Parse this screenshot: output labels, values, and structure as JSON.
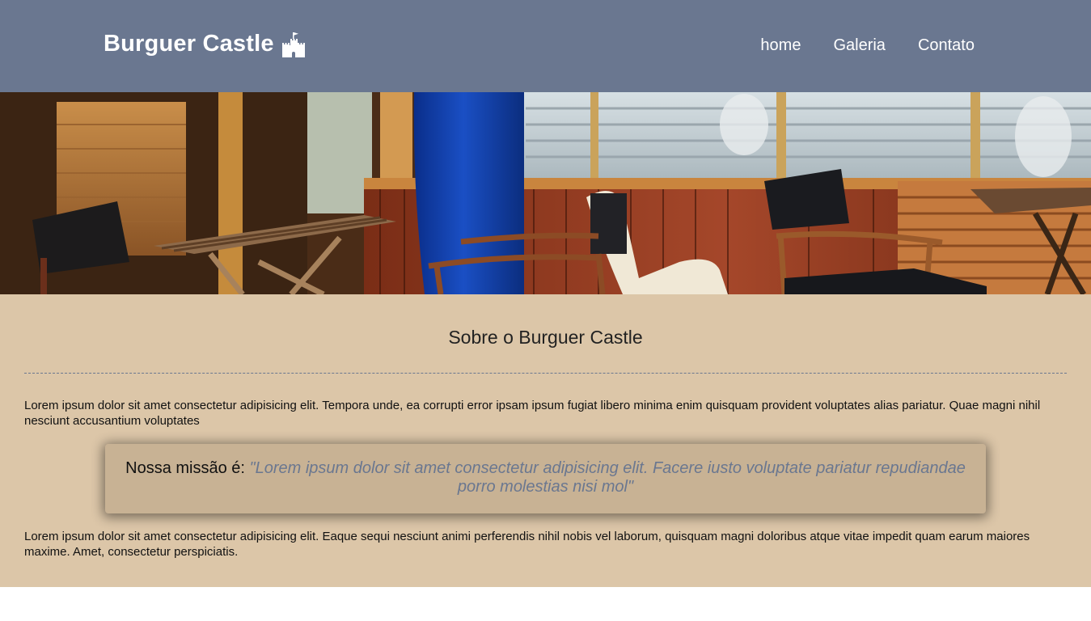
{
  "header": {
    "brand": "Burguer Castle",
    "brand_icon": "castle-icon",
    "background": "#6a7790",
    "nav": [
      {
        "label": "home"
      },
      {
        "label": "Galeria"
      },
      {
        "label": "Contato"
      }
    ]
  },
  "hero": {
    "image": "cafe-terrace-photo"
  },
  "about": {
    "title": "Sobre o Burguer Castle",
    "paragraph_1": "Lorem ipsum dolor sit amet consectetur adipisicing elit. Tempora unde, ea corrupti error ipsam ipsum fugiat libero minima enim quisquam provident voluptates alias pariatur. Quae magni nihil nesciunt accusantium voluptates",
    "mission_label": "Nossa missão é:",
    "mission_quote": "\"Lorem ipsum dolor sit amet consectetur adipisicing elit. Facere iusto voluptate pariatur repudiandae porro molestias nisi mol\"",
    "paragraph_2": "Lorem ipsum dolor sit amet consectetur adipisicing elit. Eaque sequi nesciunt animi perferendis nihil nobis vel laborum, quisquam magni doloribus atque vitae impedit quam earum maiores maxime. Amet, consectetur perspiciatis.",
    "background": "#dcc6a8",
    "mission_background": "#c8b294",
    "accent": "#6a7790"
  }
}
